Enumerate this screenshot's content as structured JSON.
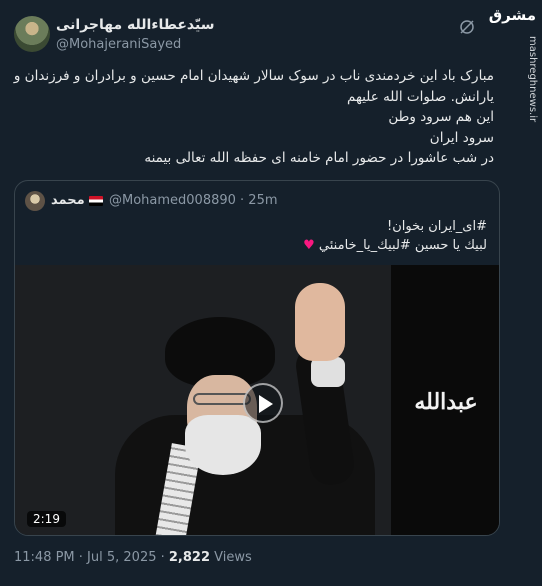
{
  "author": {
    "display_name": "سیّدعطاءالله مهاجرانی",
    "handle": "@MohajeraniSayed"
  },
  "tweet_lines": [
    "مبارک باد این خردمندی ناب در سوک سالار شهیدان امام حسین و برادران و فرزندان و",
    "یارانش. صلوات الله علیهم",
    "این هم سرود وطن",
    "سرود ایران",
    "در شب عاشورا در حضور امام خامنه ای حفظه الله تعالی بیمنه"
  ],
  "quote": {
    "name": "محمد",
    "handle_time": "@Mohamed008890 · 25m",
    "line1": "#ای_ایران بخوان!",
    "line2": "لبيك يا حسين #لبیك_یا_خامنئي",
    "heart": "♥",
    "duration": "2:19",
    "calligraphy": "عبدالله"
  },
  "meta": {
    "time": "11:48 PM · Jul 5, 2025 · ",
    "views_count": "2,822",
    "views_label": " Views"
  },
  "watermark": {
    "logo": "مشرق",
    "url": "mashreghnews.ir"
  },
  "icons": {
    "grok": "grok-icon",
    "play": "play-icon"
  },
  "colors": {
    "background": "#15202b",
    "text": "#e7e9ea",
    "muted": "#8b98a5",
    "border": "#38444d",
    "heart": "#f91880"
  }
}
